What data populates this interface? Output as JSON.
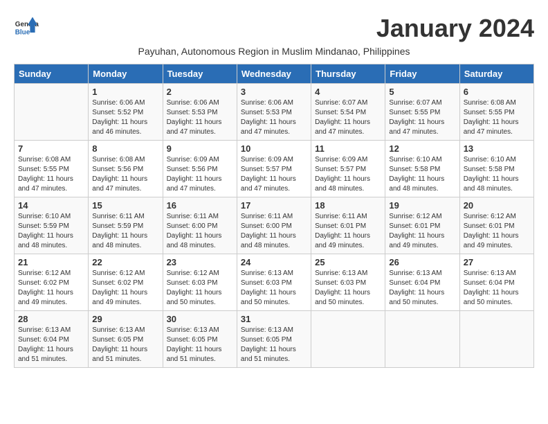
{
  "header": {
    "logo_general": "General",
    "logo_blue": "Blue",
    "month_title": "January 2024",
    "subtitle": "Payuhan, Autonomous Region in Muslim Mindanao, Philippines"
  },
  "weekdays": [
    "Sunday",
    "Monday",
    "Tuesday",
    "Wednesday",
    "Thursday",
    "Friday",
    "Saturday"
  ],
  "weeks": [
    [
      {
        "day": "",
        "sunrise": "",
        "sunset": "",
        "daylight": ""
      },
      {
        "day": "1",
        "sunrise": "Sunrise: 6:06 AM",
        "sunset": "Sunset: 5:52 PM",
        "daylight": "Daylight: 11 hours and 46 minutes."
      },
      {
        "day": "2",
        "sunrise": "Sunrise: 6:06 AM",
        "sunset": "Sunset: 5:53 PM",
        "daylight": "Daylight: 11 hours and 47 minutes."
      },
      {
        "day": "3",
        "sunrise": "Sunrise: 6:06 AM",
        "sunset": "Sunset: 5:53 PM",
        "daylight": "Daylight: 11 hours and 47 minutes."
      },
      {
        "day": "4",
        "sunrise": "Sunrise: 6:07 AM",
        "sunset": "Sunset: 5:54 PM",
        "daylight": "Daylight: 11 hours and 47 minutes."
      },
      {
        "day": "5",
        "sunrise": "Sunrise: 6:07 AM",
        "sunset": "Sunset: 5:55 PM",
        "daylight": "Daylight: 11 hours and 47 minutes."
      },
      {
        "day": "6",
        "sunrise": "Sunrise: 6:08 AM",
        "sunset": "Sunset: 5:55 PM",
        "daylight": "Daylight: 11 hours and 47 minutes."
      }
    ],
    [
      {
        "day": "7",
        "sunrise": "Sunrise: 6:08 AM",
        "sunset": "Sunset: 5:55 PM",
        "daylight": "Daylight: 11 hours and 47 minutes."
      },
      {
        "day": "8",
        "sunrise": "Sunrise: 6:08 AM",
        "sunset": "Sunset: 5:56 PM",
        "daylight": "Daylight: 11 hours and 47 minutes."
      },
      {
        "day": "9",
        "sunrise": "Sunrise: 6:09 AM",
        "sunset": "Sunset: 5:56 PM",
        "daylight": "Daylight: 11 hours and 47 minutes."
      },
      {
        "day": "10",
        "sunrise": "Sunrise: 6:09 AM",
        "sunset": "Sunset: 5:57 PM",
        "daylight": "Daylight: 11 hours and 47 minutes."
      },
      {
        "day": "11",
        "sunrise": "Sunrise: 6:09 AM",
        "sunset": "Sunset: 5:57 PM",
        "daylight": "Daylight: 11 hours and 48 minutes."
      },
      {
        "day": "12",
        "sunrise": "Sunrise: 6:10 AM",
        "sunset": "Sunset: 5:58 PM",
        "daylight": "Daylight: 11 hours and 48 minutes."
      },
      {
        "day": "13",
        "sunrise": "Sunrise: 6:10 AM",
        "sunset": "Sunset: 5:58 PM",
        "daylight": "Daylight: 11 hours and 48 minutes."
      }
    ],
    [
      {
        "day": "14",
        "sunrise": "Sunrise: 6:10 AM",
        "sunset": "Sunset: 5:59 PM",
        "daylight": "Daylight: 11 hours and 48 minutes."
      },
      {
        "day": "15",
        "sunrise": "Sunrise: 6:11 AM",
        "sunset": "Sunset: 5:59 PM",
        "daylight": "Daylight: 11 hours and 48 minutes."
      },
      {
        "day": "16",
        "sunrise": "Sunrise: 6:11 AM",
        "sunset": "Sunset: 6:00 PM",
        "daylight": "Daylight: 11 hours and 48 minutes."
      },
      {
        "day": "17",
        "sunrise": "Sunrise: 6:11 AM",
        "sunset": "Sunset: 6:00 PM",
        "daylight": "Daylight: 11 hours and 48 minutes."
      },
      {
        "day": "18",
        "sunrise": "Sunrise: 6:11 AM",
        "sunset": "Sunset: 6:01 PM",
        "daylight": "Daylight: 11 hours and 49 minutes."
      },
      {
        "day": "19",
        "sunrise": "Sunrise: 6:12 AM",
        "sunset": "Sunset: 6:01 PM",
        "daylight": "Daylight: 11 hours and 49 minutes."
      },
      {
        "day": "20",
        "sunrise": "Sunrise: 6:12 AM",
        "sunset": "Sunset: 6:01 PM",
        "daylight": "Daylight: 11 hours and 49 minutes."
      }
    ],
    [
      {
        "day": "21",
        "sunrise": "Sunrise: 6:12 AM",
        "sunset": "Sunset: 6:02 PM",
        "daylight": "Daylight: 11 hours and 49 minutes."
      },
      {
        "day": "22",
        "sunrise": "Sunrise: 6:12 AM",
        "sunset": "Sunset: 6:02 PM",
        "daylight": "Daylight: 11 hours and 49 minutes."
      },
      {
        "day": "23",
        "sunrise": "Sunrise: 6:12 AM",
        "sunset": "Sunset: 6:03 PM",
        "daylight": "Daylight: 11 hours and 50 minutes."
      },
      {
        "day": "24",
        "sunrise": "Sunrise: 6:13 AM",
        "sunset": "Sunset: 6:03 PM",
        "daylight": "Daylight: 11 hours and 50 minutes."
      },
      {
        "day": "25",
        "sunrise": "Sunrise: 6:13 AM",
        "sunset": "Sunset: 6:03 PM",
        "daylight": "Daylight: 11 hours and 50 minutes."
      },
      {
        "day": "26",
        "sunrise": "Sunrise: 6:13 AM",
        "sunset": "Sunset: 6:04 PM",
        "daylight": "Daylight: 11 hours and 50 minutes."
      },
      {
        "day": "27",
        "sunrise": "Sunrise: 6:13 AM",
        "sunset": "Sunset: 6:04 PM",
        "daylight": "Daylight: 11 hours and 50 minutes."
      }
    ],
    [
      {
        "day": "28",
        "sunrise": "Sunrise: 6:13 AM",
        "sunset": "Sunset: 6:04 PM",
        "daylight": "Daylight: 11 hours and 51 minutes."
      },
      {
        "day": "29",
        "sunrise": "Sunrise: 6:13 AM",
        "sunset": "Sunset: 6:05 PM",
        "daylight": "Daylight: 11 hours and 51 minutes."
      },
      {
        "day": "30",
        "sunrise": "Sunrise: 6:13 AM",
        "sunset": "Sunset: 6:05 PM",
        "daylight": "Daylight: 11 hours and 51 minutes."
      },
      {
        "day": "31",
        "sunrise": "Sunrise: 6:13 AM",
        "sunset": "Sunset: 6:05 PM",
        "daylight": "Daylight: 11 hours and 51 minutes."
      },
      {
        "day": "",
        "sunrise": "",
        "sunset": "",
        "daylight": ""
      },
      {
        "day": "",
        "sunrise": "",
        "sunset": "",
        "daylight": ""
      },
      {
        "day": "",
        "sunrise": "",
        "sunset": "",
        "daylight": ""
      }
    ]
  ]
}
